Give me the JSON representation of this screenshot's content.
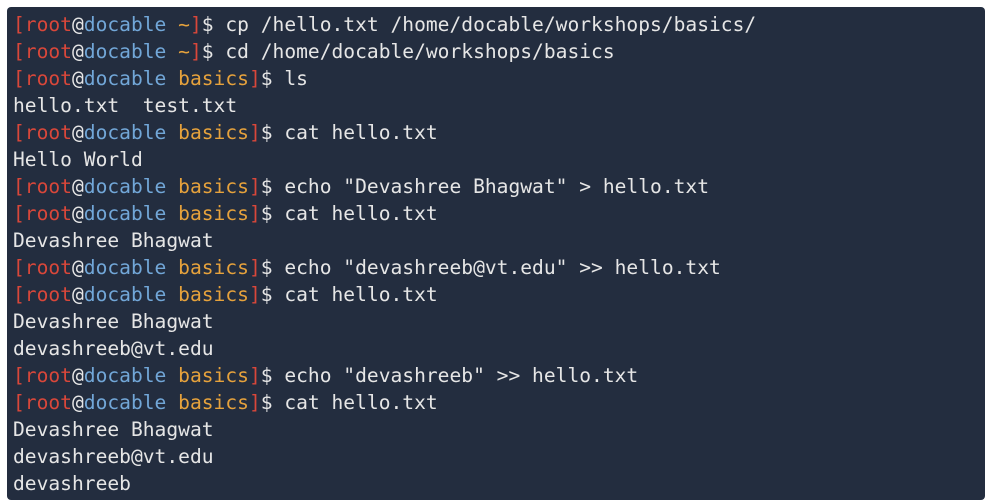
{
  "colors": {
    "terminal_bg": "#232d3f",
    "text": "#e6e6e6",
    "user": "#d9473a",
    "host": "#72a7d8",
    "dir": "#e6a23c"
  },
  "prompt": {
    "open_bracket": "[",
    "user": "root",
    "at": "@",
    "host": "docable",
    "close_bracket": "]",
    "dollar": "$ "
  },
  "lines": [
    {
      "type": "prompt",
      "dir": "~",
      "cmd": "cp /hello.txt /home/docable/workshops/basics/"
    },
    {
      "type": "prompt",
      "dir": "~",
      "cmd": "cd /home/docable/workshops/basics"
    },
    {
      "type": "prompt",
      "dir": "basics",
      "cmd": "ls"
    },
    {
      "type": "output",
      "text": "hello.txt  test.txt"
    },
    {
      "type": "prompt",
      "dir": "basics",
      "cmd": "cat hello.txt"
    },
    {
      "type": "output",
      "text": "Hello World"
    },
    {
      "type": "prompt",
      "dir": "basics",
      "cmd": "echo \"Devashree Bhagwat\" > hello.txt"
    },
    {
      "type": "prompt",
      "dir": "basics",
      "cmd": "cat hello.txt"
    },
    {
      "type": "output",
      "text": "Devashree Bhagwat"
    },
    {
      "type": "prompt",
      "dir": "basics",
      "cmd": "echo \"devashreeb@vt.edu\" >> hello.txt"
    },
    {
      "type": "prompt",
      "dir": "basics",
      "cmd": "cat hello.txt"
    },
    {
      "type": "output",
      "text": "Devashree Bhagwat"
    },
    {
      "type": "output",
      "text": "devashreeb@vt.edu"
    },
    {
      "type": "prompt",
      "dir": "basics",
      "cmd": "echo \"devashreeb\" >> hello.txt"
    },
    {
      "type": "prompt",
      "dir": "basics",
      "cmd": "cat hello.txt"
    },
    {
      "type": "output",
      "text": "Devashree Bhagwat"
    },
    {
      "type": "output",
      "text": "devashreeb@vt.edu"
    },
    {
      "type": "output",
      "text": "devashreeb"
    }
  ]
}
